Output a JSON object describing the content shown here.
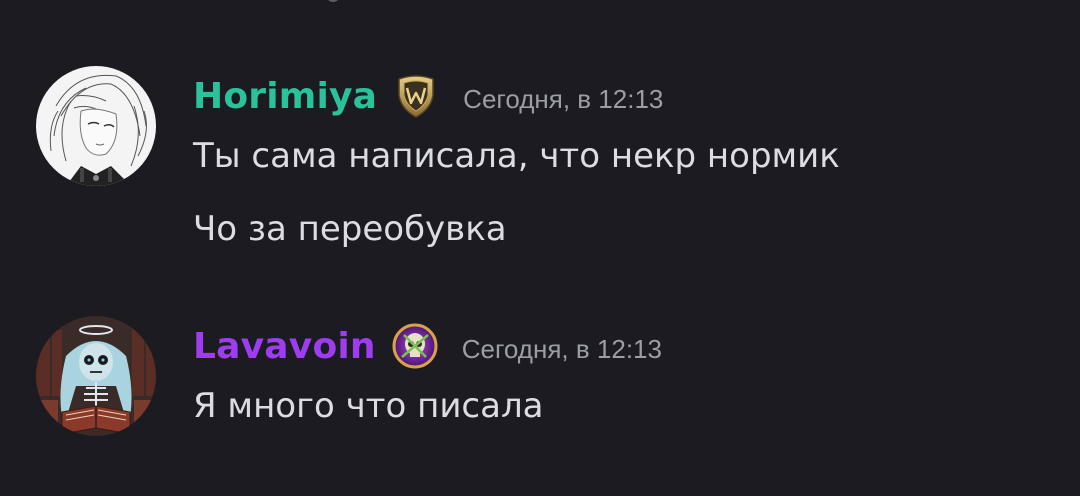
{
  "messages": [
    {
      "author": "Horimiya",
      "author_color": "#2ac29a",
      "badge_icon": "shield-w-badge-icon",
      "timestamp": "Сегодня, в 12:13",
      "lines": [
        "Ты сама написала, что некр нормик",
        "Чо за переобувка"
      ]
    },
    {
      "author": "Lavavoin",
      "author_color": "#9e3cf0",
      "badge_icon": "skull-badge-icon",
      "timestamp": "Сегодня, в 12:13",
      "lines": [
        "Я много что писала"
      ]
    }
  ]
}
